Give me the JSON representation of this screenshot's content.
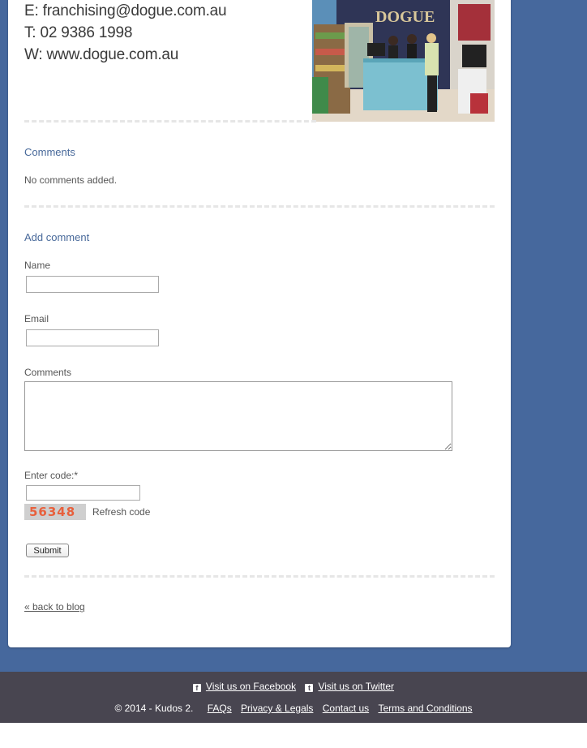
{
  "contact": {
    "email_line": "E: franchising@dogue.com.au",
    "phone_line": "T: 02 9386 1998",
    "web_line": "W: www.dogue.com.au"
  },
  "photo": {
    "alt": "DOGUE store interior with staff at counter",
    "sign_text": "DOGUE"
  },
  "comments": {
    "heading": "Comments",
    "empty_text": "No comments added."
  },
  "add_comment": {
    "heading": "Add comment",
    "name_label": "Name",
    "name_value": "",
    "email_label": "Email",
    "email_value": "",
    "comments_label": "Comments",
    "comments_value": "",
    "code_label": "Enter code:*",
    "code_value": "",
    "captcha_code": "56348",
    "refresh_label": "Refresh code",
    "submit_label": "Submit"
  },
  "back_link": "« back to blog",
  "footer": {
    "facebook_label": "Visit us on Facebook",
    "twitter_label": "Visit us on Twitter",
    "copyright": "© 2014 - Kudos 2.",
    "links": [
      "FAQs",
      "Privacy & Legals",
      "Contact us",
      "Terms and Conditions"
    ]
  },
  "colors": {
    "page_background": "#46689d",
    "heading_blue": "#48699a",
    "footer_background": "#484550",
    "captcha_text": "#e8603c"
  }
}
